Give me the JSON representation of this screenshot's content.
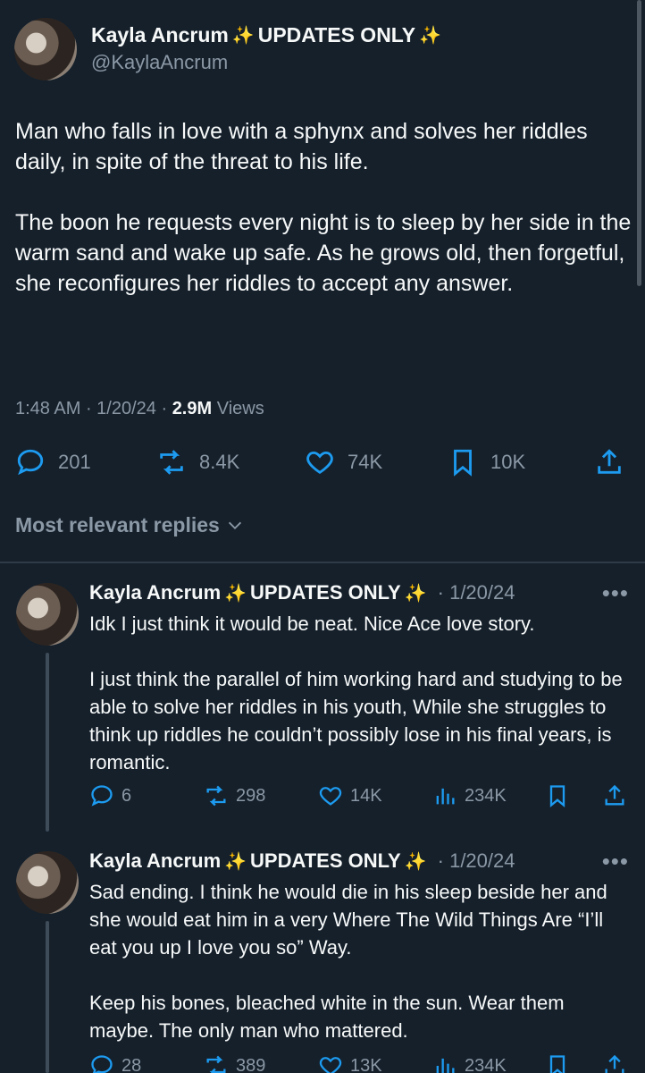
{
  "main_tweet": {
    "display_name": "Kayla Ancrum",
    "name_suffix": "UPDATES ONLY",
    "sparkle": "✨",
    "handle": "@KaylaAncrum",
    "text": "Man who falls in love with a sphynx and solves her riddles daily, in spite of the threat to his life.\n\nThe boon he requests every night is to sleep by her side in the warm sand and wake up safe. As he grows old, then forgetful, she reconfigures her riddles to accept any answer.",
    "time": "1:48 AM",
    "date": "1/20/24",
    "views_count": "2.9M",
    "views_label": "Views",
    "replies": "201",
    "reposts": "8.4K",
    "likes": "74K",
    "bookmarks": "10K"
  },
  "replies_sort": "Most relevant replies",
  "replies": [
    {
      "display_name": "Kayla Ancrum",
      "name_suffix": "UPDATES ONLY",
      "sparkle": "✨",
      "date": "· 1/20/24",
      "more": "•••",
      "text": "Idk I just think it would be neat. Nice Ace love story.\n\nI just think the parallel of him working hard and studying to be able to solve her riddles in his youth, While she struggles to think up riddles he couldn’t possibly lose in his final years, is romantic.",
      "replies": "6",
      "reposts": "298",
      "likes": "14K",
      "views": "234K"
    },
    {
      "display_name": "Kayla Ancrum",
      "name_suffix": "UPDATES ONLY",
      "sparkle": "✨",
      "date": "· 1/20/24",
      "more": "•••",
      "text": "Sad ending. I think he would die in his sleep beside her and she would  eat him in a very Where The Wild Things Are “I’ll eat you up I love you so” Way.\n\nKeep his bones, bleached white in the sun. Wear them maybe.  The only man who mattered.",
      "replies": "28",
      "reposts": "389",
      "likes": "13K",
      "views": "234K"
    }
  ],
  "colors": {
    "background": "#15202b",
    "text_primary": "#f7f9f9",
    "text_secondary": "#8b98a5",
    "divider": "#2f3b47"
  },
  "icons": [
    "reply-icon",
    "repost-icon",
    "like-icon",
    "bookmark-icon",
    "share-icon",
    "views-icon",
    "chevron-down-icon",
    "more-icon",
    "sparkle-icon"
  ]
}
